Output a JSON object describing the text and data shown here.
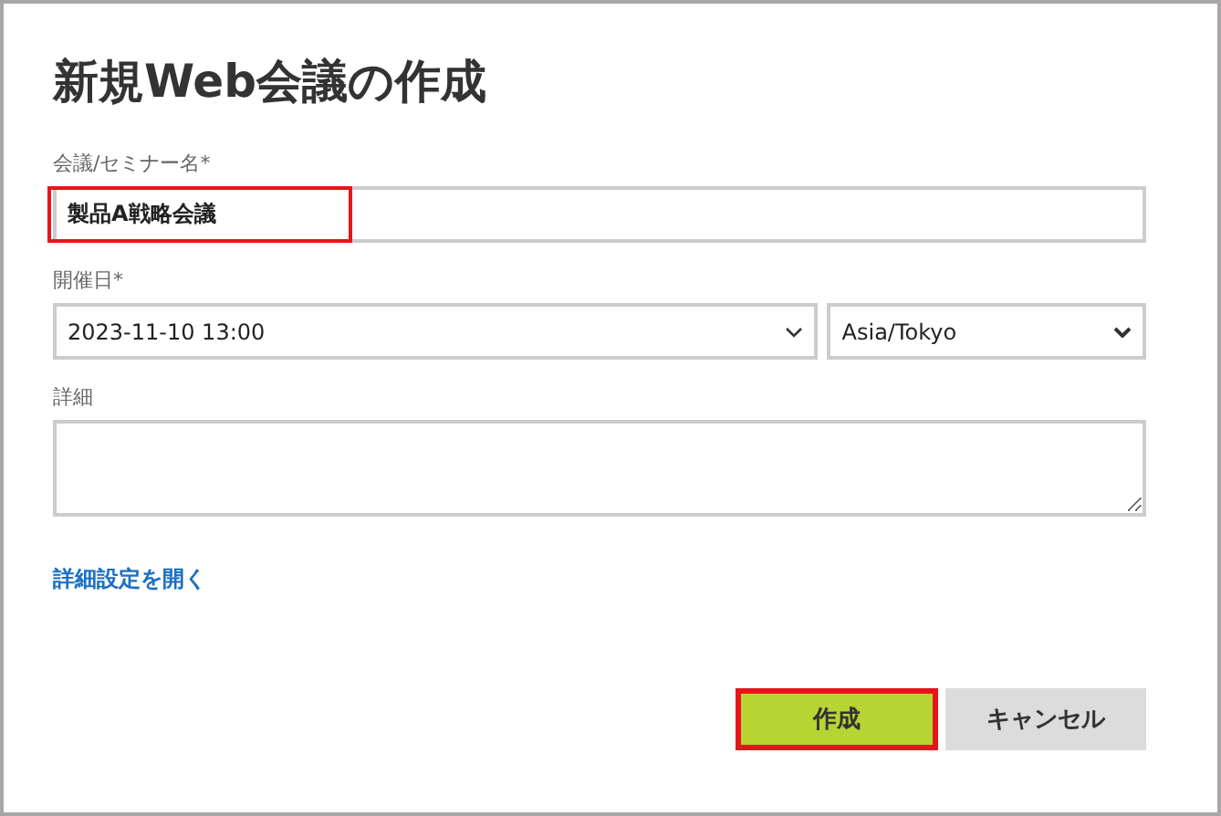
{
  "dialog": {
    "title": "新規Web会議の作成"
  },
  "fields": [
    {
      "kind": "text",
      "label": "会議/セミナー名*",
      "value": "製品A戦略会議",
      "highlighted": true
    },
    {
      "kind": "datetime",
      "label": "開催日*",
      "value": "2023-11-10 13:00",
      "timezone": "Asia/Tokyo"
    },
    {
      "kind": "textarea",
      "label": "詳細"
    }
  ],
  "advanced_link": "詳細設定を開く",
  "buttons": [
    {
      "label": "作成",
      "kind": "primary",
      "highlighted": true
    },
    {
      "label": "キャンセル",
      "kind": "secondary",
      "highlighted": false
    }
  ]
}
